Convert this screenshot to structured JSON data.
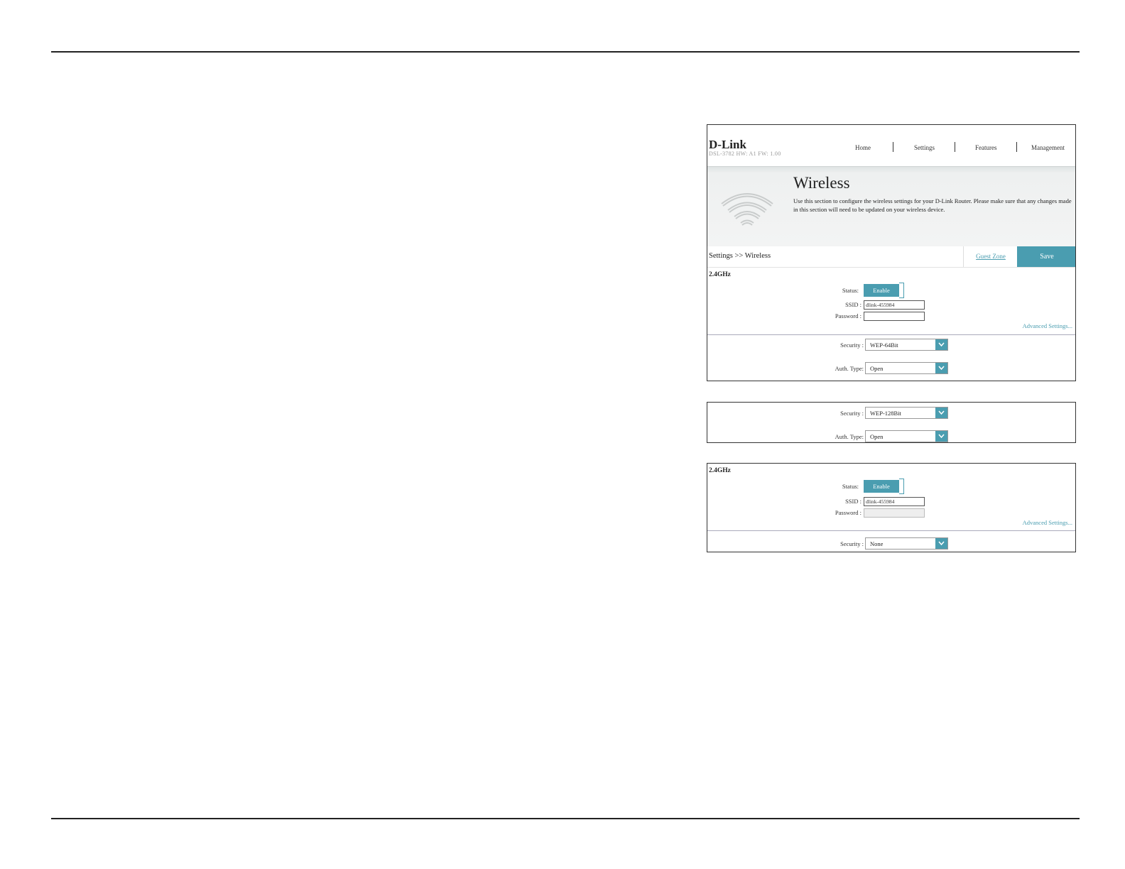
{
  "header": {
    "logo": "D-Link",
    "model": "DSL-3782  HW: A1  FW: 1.00",
    "nav": [
      "Home",
      "Settings",
      "Features",
      "Management"
    ]
  },
  "banner": {
    "title": "Wireless",
    "description": "Use this section to configure the wireless settings for your D-Link Router. Please make sure that any changes made in this section will need to be updated on your wireless device."
  },
  "toolbar": {
    "breadcrumb": "Settings >> Wireless",
    "guest_zone": "Guest Zone",
    "save": "Save"
  },
  "panel1": {
    "band": "2.4GHz",
    "status_label": "Status:",
    "status_value": "Enable",
    "ssid_label": "SSID :",
    "ssid_value": "dlink-455984",
    "password_label": "Password :",
    "password_value": "",
    "advanced": "Advanced Settings...",
    "security_label": "Security :",
    "security_value": "WEP-64Bit",
    "auth_label": "Auth. Type:",
    "auth_value": "Open"
  },
  "panel2": {
    "security_label": "Security :",
    "security_value": "WEP-128Bit",
    "auth_label": "Auth. Type:",
    "auth_value": "Open"
  },
  "panel3": {
    "band": "2.4GHz",
    "status_label": "Status:",
    "status_value": "Enable",
    "ssid_label": "SSID :",
    "ssid_value": "dlink-455984",
    "password_label": "Password :",
    "password_value": "",
    "advanced": "Advanced Settings...",
    "security_label": "Security :",
    "security_value": "None"
  },
  "colors": {
    "accent": "#4a9db0"
  }
}
